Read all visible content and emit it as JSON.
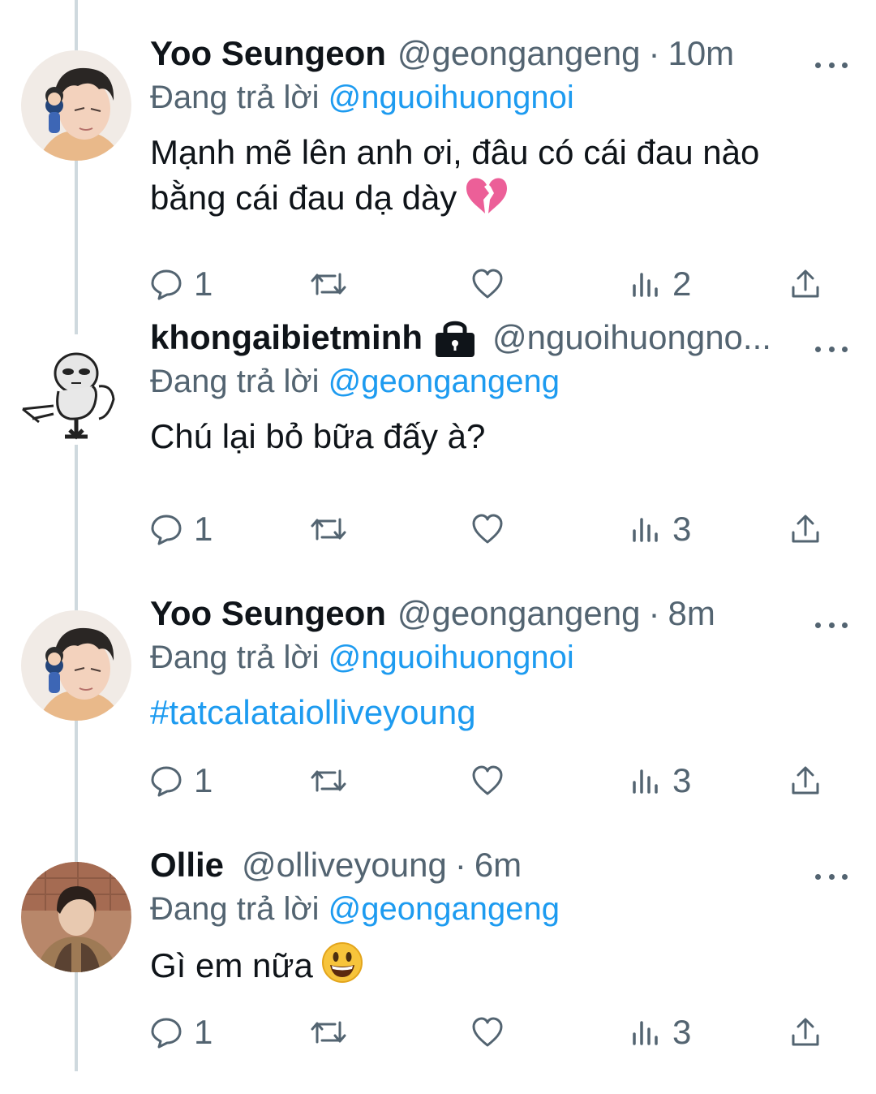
{
  "reply_prefix": "Đang trả lời",
  "tweets": [
    {
      "name": "Yoo Seungeon",
      "handle": "@geongangeng",
      "dot": "·",
      "time": "10m",
      "reply_to": "@nguoihuongnoi",
      "text_lines": [
        "Mạnh mẽ lên anh ơi, đâu có cái đau nào",
        "bằng cái đau dạ dày"
      ],
      "emoji": "broken-heart-icon",
      "replies": "1",
      "views": "2"
    },
    {
      "name": "khongaibietminh",
      "locked": true,
      "handle": "@nguoihuongno...",
      "reply_to": "@geongangeng",
      "text_lines": [
        "Chú lại bỏ bữa đấy à?"
      ],
      "replies": "1",
      "views": "3"
    },
    {
      "name": "Yoo Seungeon",
      "handle": "@geongangeng",
      "dot": "·",
      "time": "8m",
      "reply_to": "@nguoihuongnoi",
      "hashtag": "#tatcalataiolliveyoung",
      "replies": "1",
      "views": "3"
    },
    {
      "name": "Ollie",
      "handle": "@olliveyoung",
      "dot": "·",
      "time": "6m",
      "reply_to": "@geongangeng",
      "text_lines": [
        "Gì em nữa"
      ],
      "emoji": "grinning-face-icon",
      "replies": "1",
      "views": "3"
    }
  ],
  "colors": {
    "link": "#1d9bf0",
    "muted": "#536471",
    "text": "#0f1419",
    "thread": "#cfd9de"
  }
}
